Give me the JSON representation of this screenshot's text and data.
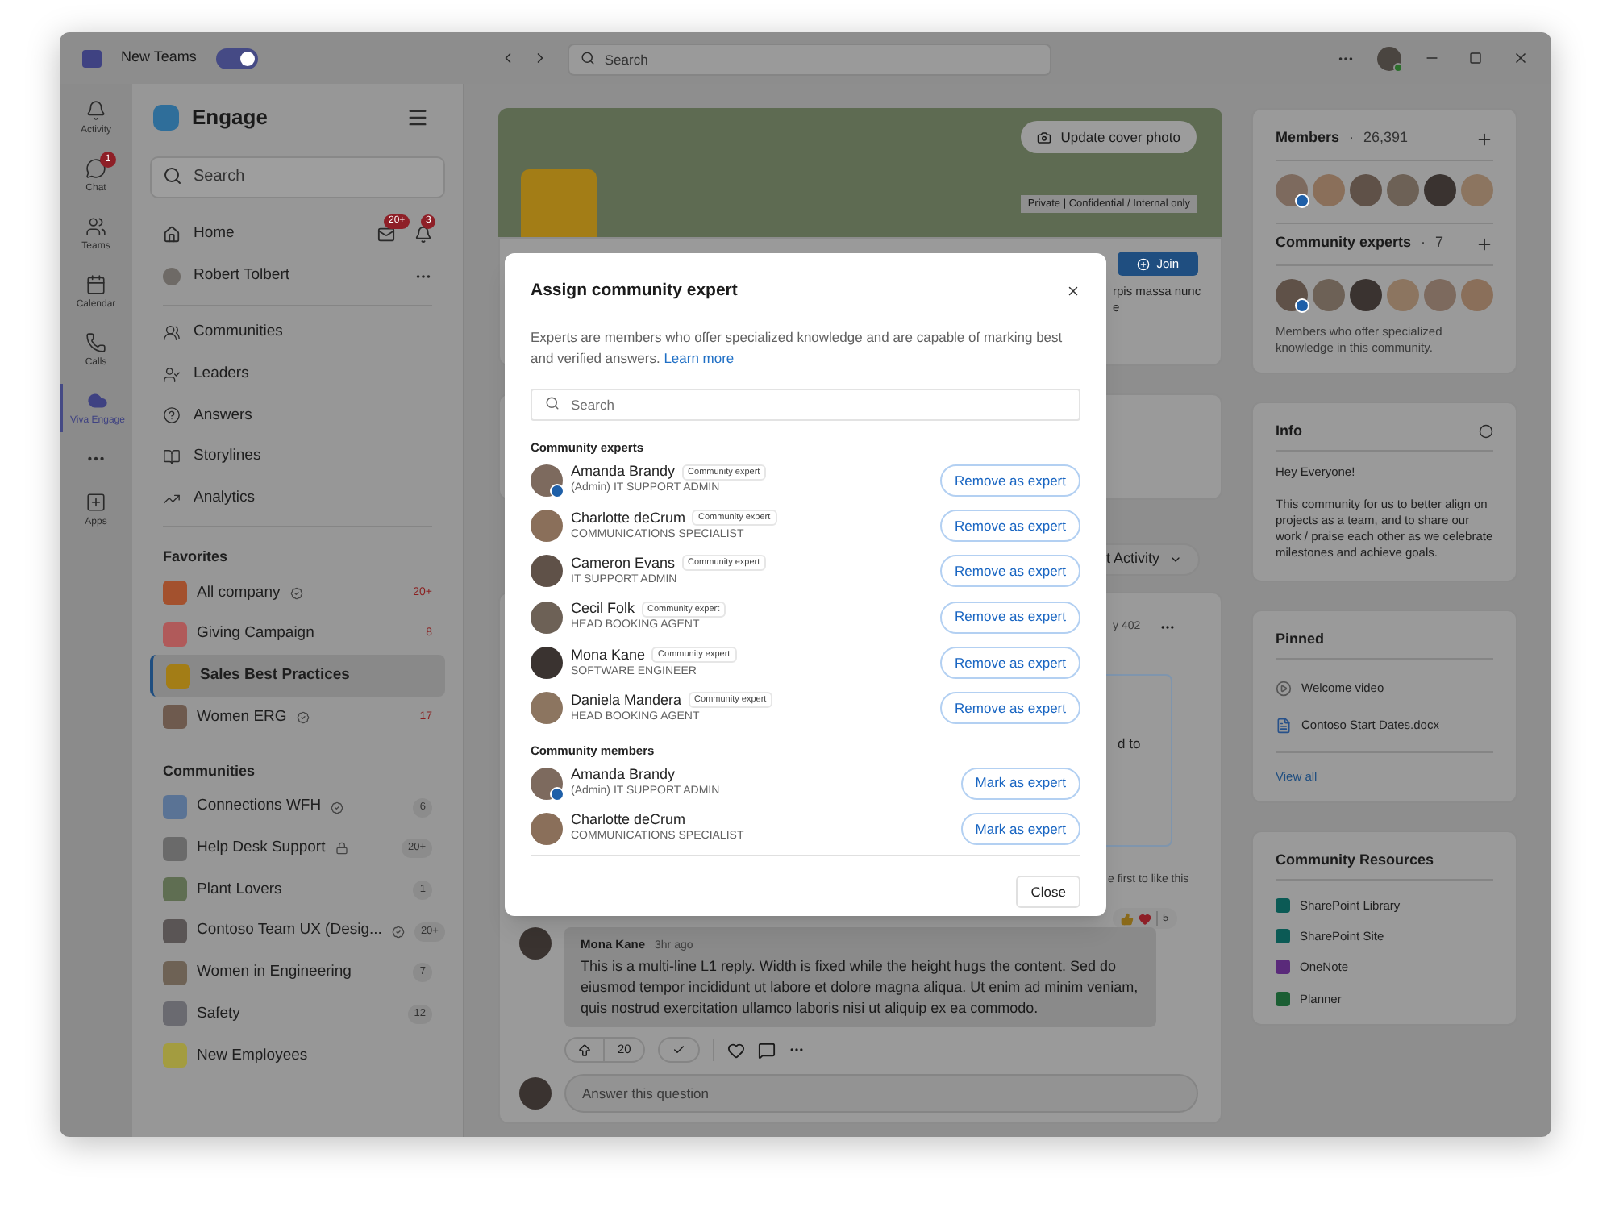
{
  "title_bar": {
    "app_name": "New Teams",
    "toggle": {
      "on": true
    },
    "search": {
      "placeholder": "Search"
    }
  },
  "rail": {
    "items": [
      {
        "label": "Activity",
        "selected": false
      },
      {
        "label": "Chat",
        "selected": false,
        "badge": "1"
      },
      {
        "label": "Teams",
        "selected": false
      },
      {
        "label": "Calendar",
        "selected": false
      },
      {
        "label": "Calls",
        "selected": false
      },
      {
        "label": "Viva Engage",
        "selected": true
      }
    ],
    "apps": "Apps"
  },
  "sidebar": {
    "title": "Engage",
    "search": {
      "placeholder": "Search"
    },
    "home": {
      "label": "Home",
      "badges": [
        "20+",
        "3"
      ]
    },
    "user": "Robert Tolbert",
    "nav": [
      "Communities",
      "Leaders",
      "Answers",
      "Storylines",
      "Analytics"
    ],
    "groups": [
      {
        "heading": "Favorites",
        "kind": "favorites",
        "items": [
          {
            "name": "All company",
            "verified": true,
            "locked": false,
            "count": "20+",
            "selected": false
          },
          {
            "name": "Giving Campaign",
            "verified": false,
            "locked": false,
            "count": "8",
            "selected": false
          },
          {
            "name": "Sales Best Practices",
            "verified": false,
            "locked": false,
            "selected": true
          },
          {
            "name": "Women ERG",
            "verified": true,
            "locked": false,
            "count": "17",
            "selected": false
          }
        ]
      },
      {
        "heading": "Communities",
        "kind": "communities",
        "items": [
          {
            "name": "Connections WFH",
            "verified": true,
            "locked": false,
            "count": "6",
            "selected": false
          },
          {
            "name": "Help Desk Support",
            "verified": false,
            "locked": true,
            "count": "20+",
            "selected": false
          },
          {
            "name": "Plant Lovers",
            "verified": false,
            "locked": false,
            "count": "1",
            "selected": false
          },
          {
            "name": "Contoso Team UX (Desig...",
            "verified": true,
            "locked": false,
            "count": "20+",
            "selected": false
          },
          {
            "name": "Women in Engineering",
            "verified": false,
            "locked": false,
            "count": "7",
            "selected": false
          },
          {
            "name": "Safety",
            "verified": false,
            "locked": false,
            "count": "12",
            "selected": false
          },
          {
            "name": "New Employees",
            "verified": false,
            "locked": false,
            "selected": false
          }
        ]
      }
    ]
  },
  "main": {
    "cover": {
      "button": "Update cover photo",
      "label": "Private | Confidential / Internal only"
    },
    "header_card": {
      "join": "Join",
      "text_lines": [
        "rpis massa nunc",
        "e"
      ]
    },
    "sort": {
      "label": "t Activity"
    },
    "post": {
      "stat": "y 402",
      "quote_text": "d to",
      "likes": "e first to like this",
      "reactions": "5",
      "reply": {
        "author": "Mona Kane",
        "time": "3hr ago",
        "text": "This is a multi-line L1 reply. Width is fixed while the height hugs the content. Sed do eiusmod tempor incididunt ut labore et dolore magna aliqua. Ut enim ad minim veniam, quis nostrud exercitation ullamco laboris nisi ut aliquip ex ea commodo."
      },
      "upvotes": "20",
      "answer": {
        "placeholder": "Answer this question"
      }
    }
  },
  "right": {
    "members": {
      "title": "Members",
      "dot": "·",
      "count": "26,391"
    },
    "experts": {
      "title": "Community experts",
      "dot": "·",
      "count": "7",
      "description": "Members who offer specialized knowledge in this community."
    },
    "info": {
      "title": "Info",
      "paragraphs": [
        "Hey Everyone!",
        "This community for us to better align on projects as a team, and to share our work / praise each other as we celebrate milestones and achieve goals."
      ]
    },
    "pinned": {
      "title": "Pinned",
      "items": [
        "Welcome video",
        "Contoso Start Dates.docx"
      ],
      "link": "View all"
    },
    "resources": {
      "title": "Community Resources",
      "items": [
        "SharePoint Library",
        "SharePoint Site",
        "OneNote",
        "Planner"
      ]
    }
  },
  "modal": {
    "title": "Assign community expert",
    "description": "Experts are members who offer specialized knowledge and are capable of marking best and verified answers.",
    "link": "Learn more",
    "search": {
      "placeholder": "Search"
    },
    "sections": [
      {
        "heading": "Community experts",
        "people": [
          {
            "name": "Amanda Brandy",
            "tag": "Community expert",
            "role": "(Admin) IT SUPPORT ADMIN",
            "admin_badge": true,
            "action": "Remove as expert"
          },
          {
            "name": "Charlotte deCrum",
            "tag": "Community expert",
            "role": "COMMUNICATIONS SPECIALIST",
            "admin_badge": false,
            "action": "Remove as expert"
          },
          {
            "name": "Cameron Evans",
            "tag": "Community expert",
            "role": "IT SUPPORT ADMIN",
            "admin_badge": false,
            "action": "Remove as expert"
          },
          {
            "name": "Cecil Folk",
            "tag": "Community expert",
            "role": "HEAD BOOKING AGENT",
            "admin_badge": false,
            "action": "Remove as expert"
          },
          {
            "name": "Mona Kane",
            "tag": "Community expert",
            "role": "SOFTWARE ENGINEER",
            "admin_badge": false,
            "action": "Remove as expert"
          },
          {
            "name": "Daniela Mandera",
            "tag": "Community expert",
            "role": "HEAD BOOKING AGENT",
            "admin_badge": false,
            "action": "Remove as expert"
          }
        ]
      },
      {
        "heading": "Community members",
        "people": [
          {
            "name": "Amanda Brandy",
            "role": "(Admin) IT SUPPORT ADMIN",
            "admin_badge": true,
            "action": "Mark as expert"
          },
          {
            "name": "Charlotte deCrum",
            "role": "COMMUNICATIONS SPECIALIST",
            "admin_badge": false,
            "action": "Mark as expert"
          }
        ]
      }
    ],
    "close": "Close"
  }
}
